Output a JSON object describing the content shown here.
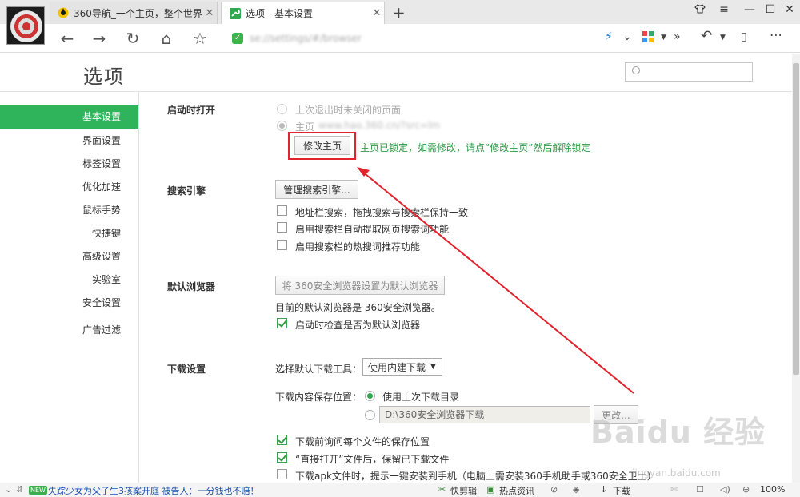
{
  "tabs": [
    {
      "title": "360导航_一个主页，整个世界",
      "active": false
    },
    {
      "title": "选项 - 基本设置",
      "active": true
    }
  ],
  "toolbar": {
    "url": "se://settings/#/browser"
  },
  "page": {
    "title": "选项",
    "search_placeholder": ""
  },
  "sidebar": {
    "items": [
      {
        "label": "基本设置",
        "active": true
      },
      {
        "label": "界面设置"
      },
      {
        "label": "标签设置"
      },
      {
        "label": "优化加速"
      },
      {
        "label": "鼠标手势"
      },
      {
        "label": "快捷键"
      },
      {
        "label": "高级设置"
      },
      {
        "label": "实验室"
      },
      {
        "label": "安全设置"
      },
      {
        "label": "广告过滤"
      }
    ]
  },
  "startup": {
    "label": "启动时打开",
    "option_restore": "上次退出时未关闭的页面",
    "option_home": "主页",
    "home_url": "www.hao.360.cn/?src=lm",
    "modify_button": "修改主页",
    "locked_message": "主页已锁定，如需修改，请点“修改主页”然后解除锁定"
  },
  "search_engine": {
    "label": "搜索引擎",
    "manage_button": "管理搜索引擎...",
    "options": [
      {
        "label": "地址栏搜索，拖拽搜索与搜索栏保持一致",
        "checked": false
      },
      {
        "label": "启用搜索栏自动提取网页搜索词功能",
        "checked": false
      },
      {
        "label": "启用搜索栏的热搜词推荐功能",
        "checked": false
      }
    ]
  },
  "default_browser": {
    "label": "默认浏览器",
    "set_button": "将 360安全浏览器设置为默认浏览器",
    "status": "目前的默认浏览器是 360安全浏览器。",
    "check_option": "启动时检查是否为默认浏览器",
    "check_checked": true
  },
  "download": {
    "label": "下载设置",
    "tool_label": "选择默认下载工具：",
    "tool_selected": "使用内建下载",
    "location_label": "下载内容保存位置：",
    "option_last_dir": "使用上次下载目录",
    "path_value": "D:\\360安全浏览器下载",
    "change_button": "更改...",
    "options": [
      {
        "label": "下载前询问每个文件的保存位置",
        "checked": true
      },
      {
        "label": "“直接打开”文件后，保留已下载文件",
        "checked": true
      },
      {
        "label": "下载apk文件时，提示一键安装到手机（电脑上需安装360手机助手或360安全卫士）",
        "checked": false
      }
    ]
  },
  "statusbar": {
    "new_badge": "NEW",
    "news": "失踪少女为父子生3孩案开庭 被告人：一分钱也不赔！",
    "clipper": "快剪辑",
    "hot_news": "热点资讯",
    "download": "下载",
    "zoom": "100%"
  },
  "watermark": {
    "logo": "Baidu 经验",
    "site": "jingyan.baidu.com"
  }
}
